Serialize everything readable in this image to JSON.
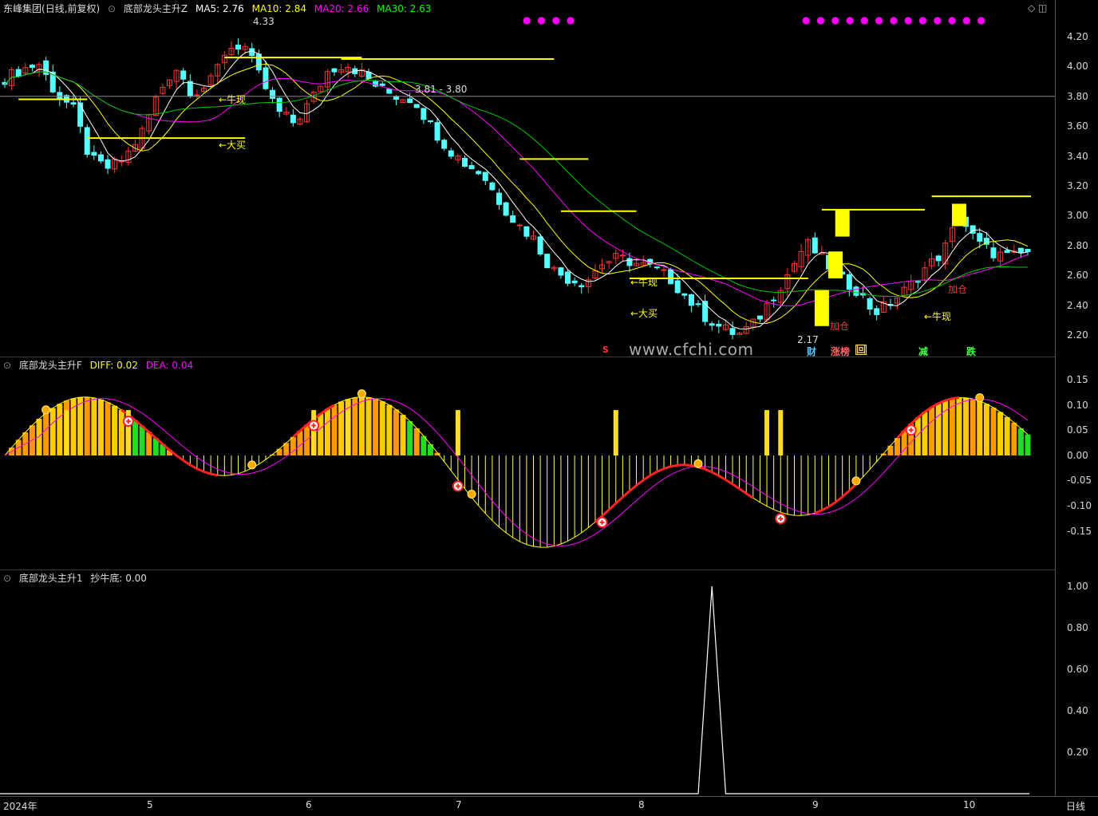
{
  "panel1": {
    "stock": "东峰集团",
    "period_note": "(日线,前复权)",
    "indicator": "底部龙头主升Z",
    "ma": [
      {
        "label": "MA5: 2.76",
        "color": "#ffffff"
      },
      {
        "label": "MA10: 2.84",
        "color": "#ffff00"
      },
      {
        "label": "MA20: 2.66",
        "color": "#ff00ff"
      },
      {
        "label": "MA30: 2.63",
        "color": "#00ff00"
      }
    ],
    "y_ticks": [
      "4.20",
      "4.00",
      "3.80",
      "3.60",
      "3.40",
      "3.20",
      "3.00",
      "2.80",
      "2.60",
      "2.40",
      "2.20"
    ],
    "annotations": {
      "high": "4.33",
      "low": "2.17",
      "range": "3.81 - 3.80",
      "niuxian1": "←牛现",
      "niuxian2": "←牛现",
      "niuxian3": "←牛现",
      "damai1": "←大买",
      "damai2": "←大买",
      "jiacang1": "加仓",
      "jiacang2": "加仓"
    },
    "signals": {
      "s": "S",
      "cai": "财",
      "zhangbang": "涨榜",
      "hui": "回",
      "jian": "减",
      "die": "跌"
    },
    "watermark": "www.cfchi.com"
  },
  "panel2": {
    "indicator": "底部龙头主升F",
    "diff": "DIFF: 0.02",
    "dea": "DEA: 0.04",
    "y_ticks": [
      "0.15",
      "0.10",
      "0.05",
      "0.00",
      "-0.05",
      "-0.10",
      "-0.15"
    ]
  },
  "panel3": {
    "indicator": "底部龙头主升1",
    "value": "抄牛底: 0.00",
    "y_ticks": [
      "1.00",
      "0.80",
      "0.60",
      "0.40",
      "0.20"
    ]
  },
  "x_axis": {
    "labels": [
      "2024年",
      "5",
      "6",
      "7",
      "8",
      "9",
      "10"
    ],
    "period_button": "日线"
  },
  "colors": {
    "up": "#ff3333",
    "down": "#54ffff",
    "ma5": "#ffffff",
    "ma10": "#ffff00",
    "ma20": "#ff00ff",
    "ma30": "#00c800"
  },
  "chart_data": [
    {
      "type": "candlestick",
      "title": "东峰集团 (日线,前复权)",
      "series": [
        {
          "name": "MA5",
          "last": 2.76
        },
        {
          "name": "MA10",
          "last": 2.84
        },
        {
          "name": "MA20",
          "last": 2.66
        },
        {
          "name": "MA30",
          "last": 2.63
        }
      ],
      "x_labels": [
        "2024年",
        "5",
        "6",
        "7",
        "8",
        "9",
        "10"
      ],
      "ylim": [
        2.13,
        4.33
      ],
      "max": 4.33,
      "min": 2.17,
      "close_path": [
        3.92,
        3.98,
        4.02,
        3.82,
        3.72,
        3.38,
        3.32,
        3.38,
        3.55,
        3.82,
        4.0,
        3.82,
        3.88,
        4.12,
        4.15,
        3.92,
        3.7,
        3.62,
        3.78,
        3.98,
        4.02,
        3.95,
        3.85,
        3.8,
        3.78,
        3.6,
        3.45,
        3.35,
        3.28,
        3.1,
        2.95,
        2.85,
        2.65,
        2.58,
        2.55,
        2.68,
        2.72,
        2.68,
        2.65,
        2.58,
        2.45,
        2.33,
        2.25,
        2.2,
        2.28,
        2.45,
        2.62,
        2.82,
        2.7,
        2.58,
        2.5,
        2.35,
        2.42,
        2.52,
        2.65,
        2.75,
        3.0,
        2.82,
        2.75,
        2.72,
        2.76
      ]
    },
    {
      "type": "bar",
      "title": "底部龙头主升F",
      "series": [
        {
          "name": "DIFF",
          "last": 0.02
        },
        {
          "name": "DEA",
          "last": 0.04
        }
      ],
      "ylim": [
        -0.22,
        0.16
      ]
    },
    {
      "type": "line",
      "title": "底部龙头主升1",
      "series": [
        {
          "name": "抄牛底",
          "last": 0.0,
          "peak": 1.0
        }
      ],
      "ylim": [
        0,
        1.0
      ]
    }
  ]
}
